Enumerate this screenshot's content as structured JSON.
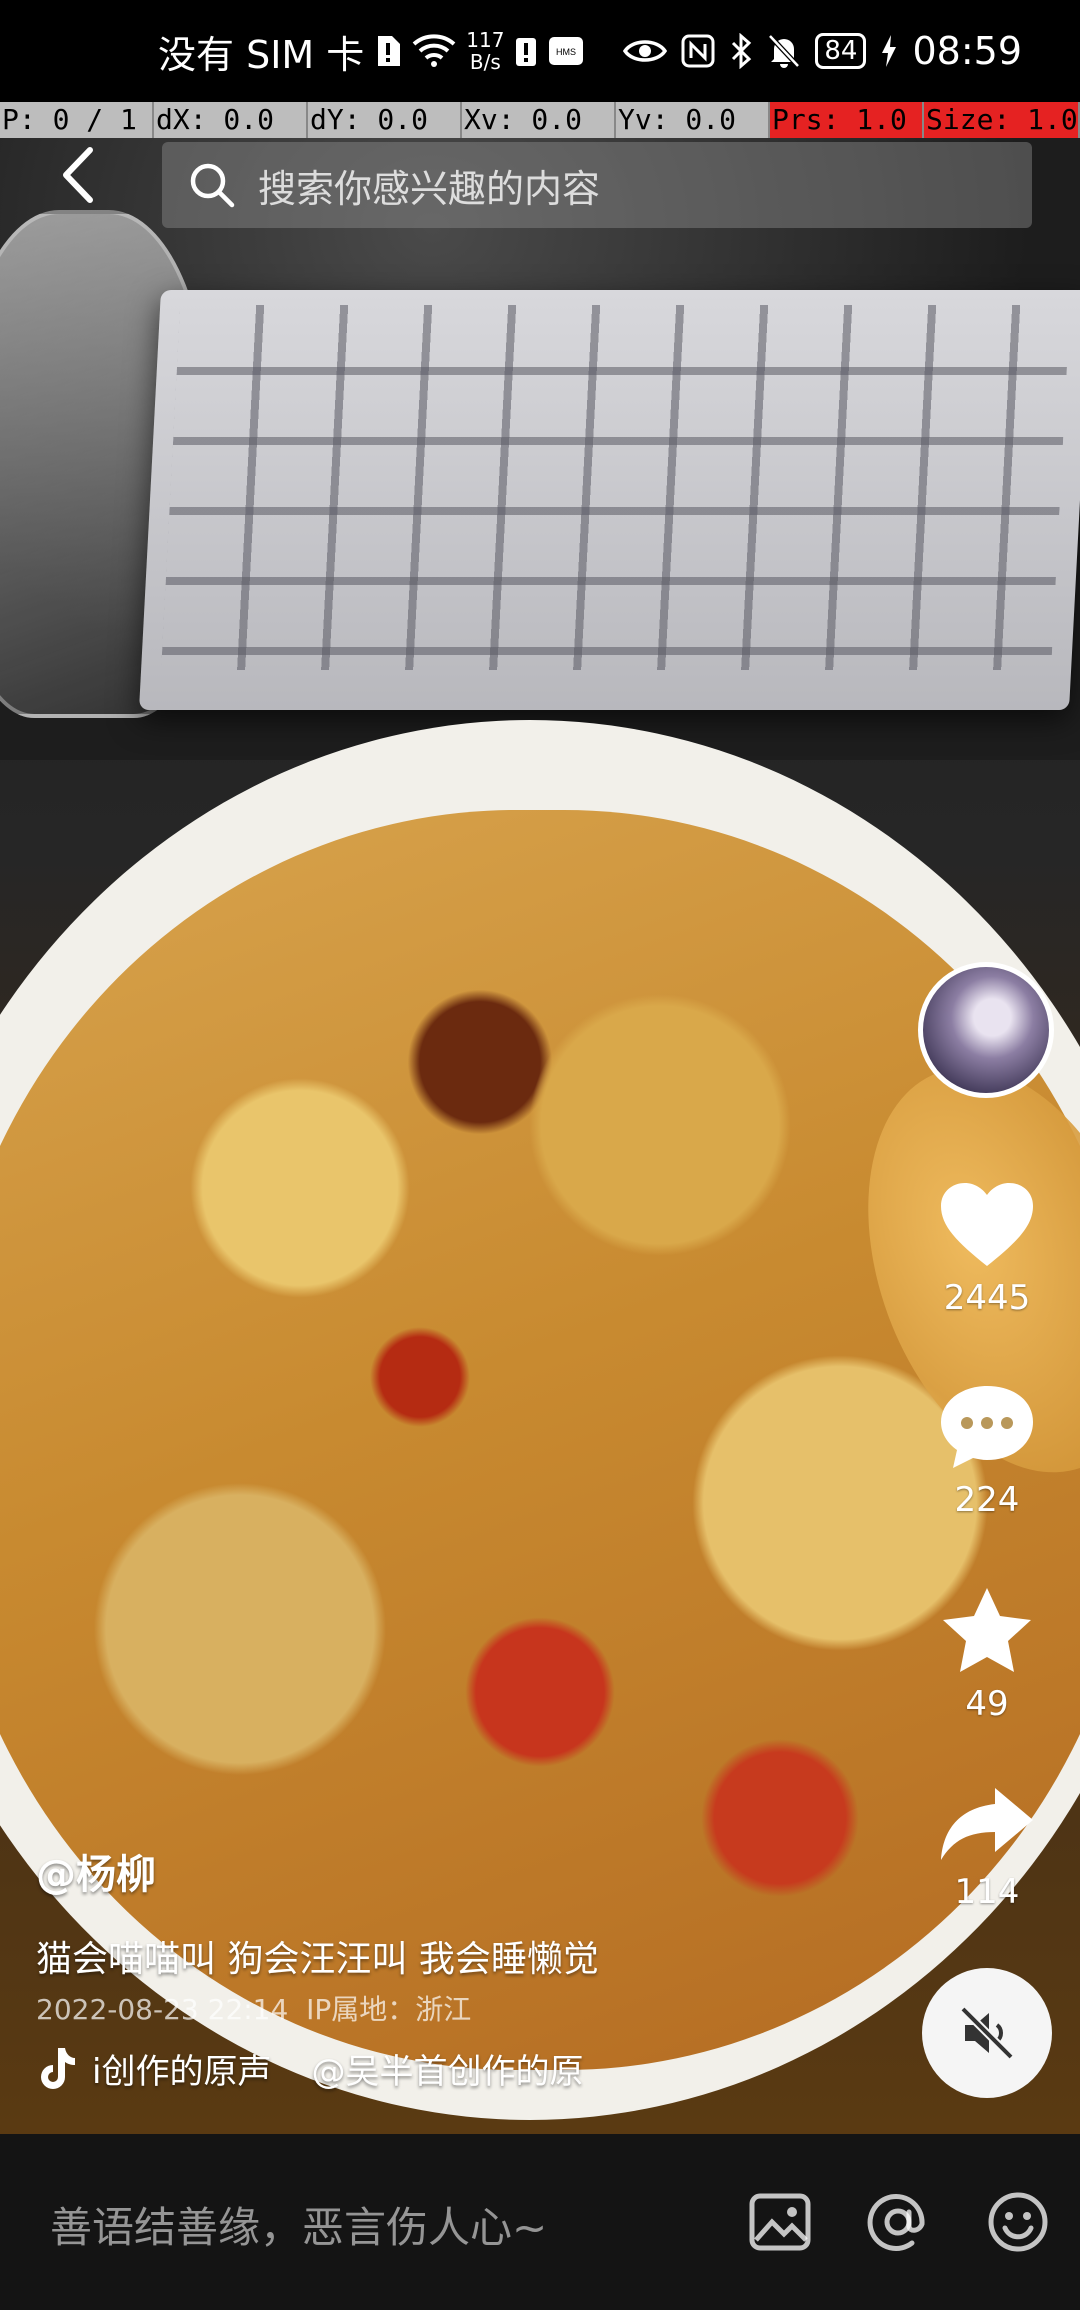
{
  "status_bar": {
    "carrier": "没有 SIM 卡",
    "net_speed_value": "117",
    "net_speed_unit": "B/s",
    "hms_label": "HMS",
    "battery": "84",
    "time": "08:59"
  },
  "debug": {
    "p": "P: 0 / 1",
    "dx": "dX: 0.0",
    "dy": "dY: 0.0",
    "xv": "Xv: 0.0",
    "yv": "Yv: 0.0",
    "prs": "Prs: 1.0",
    "size": "Size: 1.0"
  },
  "search": {
    "placeholder": "搜索你感兴趣的内容"
  },
  "actions": {
    "likes": "2445",
    "comments": "224",
    "favorites": "49",
    "shares": "114"
  },
  "post": {
    "author": "@杨柳",
    "description": "猫会喵喵叫 狗会汪汪叫 我会睡懒觉",
    "timestamp": "2022-08-23 22:14",
    "ip_location": "IP属地：浙江",
    "music_title": "i创作的原声",
    "music_author": "@吴半首创作的原"
  },
  "comment_bar": {
    "placeholder": "善语结善缘，恶言伤人心~"
  }
}
